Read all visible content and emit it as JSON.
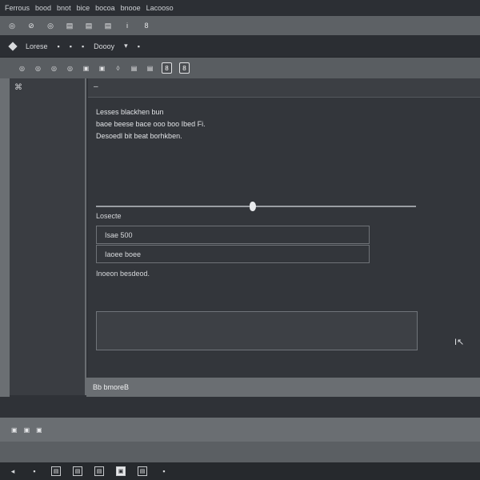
{
  "menubar": {
    "items": [
      "Ferrous",
      "bood",
      "bnot",
      "bice",
      "bocoa",
      "bnooe",
      "Lacooso"
    ]
  },
  "toolbar1": {
    "icons": [
      "◎",
      "⊘",
      "◎",
      "▤",
      "▤",
      "▤",
      "Ꭵ",
      "8"
    ]
  },
  "toolbar2": {
    "label1": "Lorese",
    "label2": "Doooy",
    "icons": [
      "⌂",
      "▪",
      "▪",
      "▪",
      "▾",
      "▪"
    ]
  },
  "toolbar3": {
    "icons": [
      "◎",
      "◎",
      "◎",
      "◎",
      "▣",
      "▣",
      "◊",
      "▤",
      "▤",
      "Ꭰ"
    ],
    "boxed": [
      "8",
      "8"
    ]
  },
  "sidebar": {
    "corner_icon": "⌘"
  },
  "main": {
    "header_mark": "–",
    "lines": [
      "Lesses blackhen bun",
      "baoe beese bace ooo boo Ibed Fi.",
      "Desoedl bit beat borhkben."
    ],
    "slider_value_pct": 49,
    "field_label": "Losecte",
    "field1_value": "Isae 500",
    "field2_value": "Iaoee boee",
    "footnote": "Inoeon besdeod.",
    "side_icon": "I↖"
  },
  "statusbar": {
    "text": "Bb bmoreB"
  },
  "panel2": {
    "icons": [
      "▣",
      "▣",
      "▣"
    ]
  },
  "taskbar": {
    "icons": [
      "◂",
      "▪"
    ],
    "boxed": [
      "▤",
      "▤",
      "▤",
      "▣",
      "▤",
      "▪"
    ]
  }
}
